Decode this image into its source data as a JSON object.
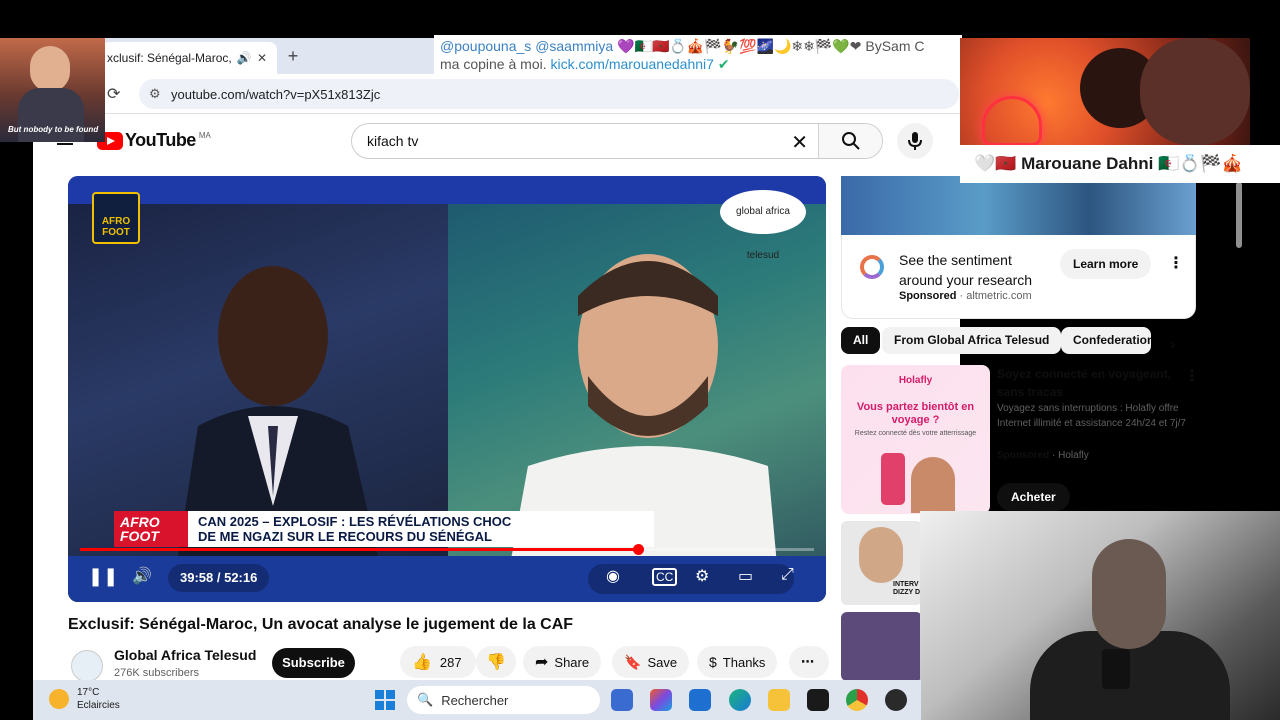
{
  "browser": {
    "tab_title": "xclusif: Sénégal-Maroc, Un",
    "url": "youtube.com/watch?v=pX51x813Zjc"
  },
  "youtube": {
    "logo_text": "YouTube",
    "country_code": "MA",
    "search_value": "kifach tv"
  },
  "video": {
    "time": "39:58 / 52:16",
    "progress_fraction": 0.76,
    "logo_left": "AFRO FOOT",
    "logo_right": "global africa telesud",
    "lower_tag": "AFRO FOOT",
    "lower_line1": "CAN 2025 – EXPLOSIF : LES RÉVÉLATIONS CHOC",
    "lower_line2": "DE ME NGAZI SUR LE RECOURS DU SÉNÉGAL",
    "title": "Exclusif: Sénégal-Maroc, Un avocat analyse le jugement de la CAF",
    "channel": "Global Africa Telesud",
    "subscribers": "276K subscribers",
    "subscribe_label": "Subscribe",
    "like_count": "287",
    "share_label": "Share",
    "save_label": "Save",
    "thanks_label": "Thanks"
  },
  "sidebar": {
    "ad": {
      "text": "See the sentiment around your research",
      "sponsored": "Sponsored",
      "domain": "altmetric.com",
      "cta": "Learn more"
    },
    "chips": [
      "All",
      "From Global Africa Telesud",
      "Confederation"
    ],
    "ad2": {
      "image_brand": "Holafly",
      "image_headline": "Vous partez bientôt en voyage ?",
      "image_sub": "Restez connecté dès votre atterrissage",
      "title": "Soyez connecté en voyageant, sans tracas",
      "desc": "Voyagez sans interruptions : Holafly offre Internet illimité et assistance 24h/24 et 7j/7",
      "sponsored": "Sponsored",
      "advertiser": "Holafly",
      "cta": "Acheter"
    },
    "thumb3_label": "INTERV DIZZY D"
  },
  "overlays": {
    "cam_caption": "But nobody to be found",
    "chat_user1": "@poupouna_s",
    "chat_user2": "@saammiya",
    "chat_emojis": "💜🇩🇿🇲🇦💍🎪🏁🐓💯🌌🌙❄❄🏁💚❤",
    "chat_suffix": "BySam C",
    "chat_line2": "ma copine à moi.",
    "chat_link": "kick.com/marouanedahni7",
    "streamer_name": "Marouane Dahni",
    "streamer_emojis_left": "🤍🇲🇦",
    "streamer_emojis_right": "🇩🇿💍🏁🎪"
  },
  "taskbar": {
    "temp": "17°C",
    "weather": "Eclaircies",
    "search_placeholder": "Rechercher"
  },
  "colors": {
    "youtube_red": "#ff0000",
    "player_blue": "#1a3b9a",
    "telesud_red": "#d9132b"
  }
}
